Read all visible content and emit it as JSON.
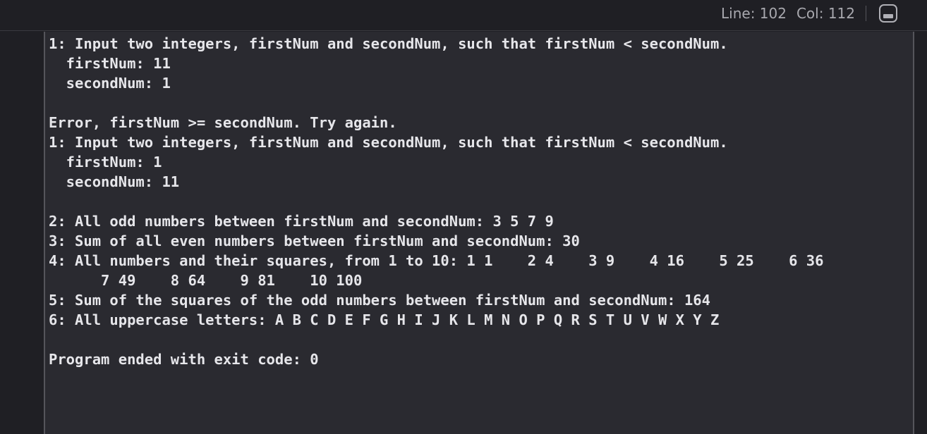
{
  "status_bar": {
    "line_label": "Line: 102",
    "col_label": "Col: 112",
    "toggle_icon": "console-toggle-icon"
  },
  "console": {
    "lines": [
      "1: Input two integers, firstNum and secondNum, such that firstNum < secondNum.",
      "  firstNum: 11",
      "  secondNum: 1",
      "",
      "Error, firstNum >= secondNum. Try again.",
      "1: Input two integers, firstNum and secondNum, such that firstNum < secondNum.",
      "  firstNum: 1",
      "  secondNum: 11",
      "",
      "2: All odd numbers between firstNum and secondNum: 3 5 7 9",
      "3: Sum of all even numbers between firstNum and secondNum: 30",
      "4: All numbers and their squares, from 1 to 10: 1 1    2 4    3 9    4 16    5 25    6 36",
      "      7 49    8 64    9 81    10 100",
      "5: Sum of the squares of the odd numbers between firstNum and secondNum: 164",
      "6: All uppercase letters: A B C D E F G H I J K L M N O P Q R S T U V W X Y Z",
      "",
      "Program ended with exit code: 0"
    ]
  }
}
